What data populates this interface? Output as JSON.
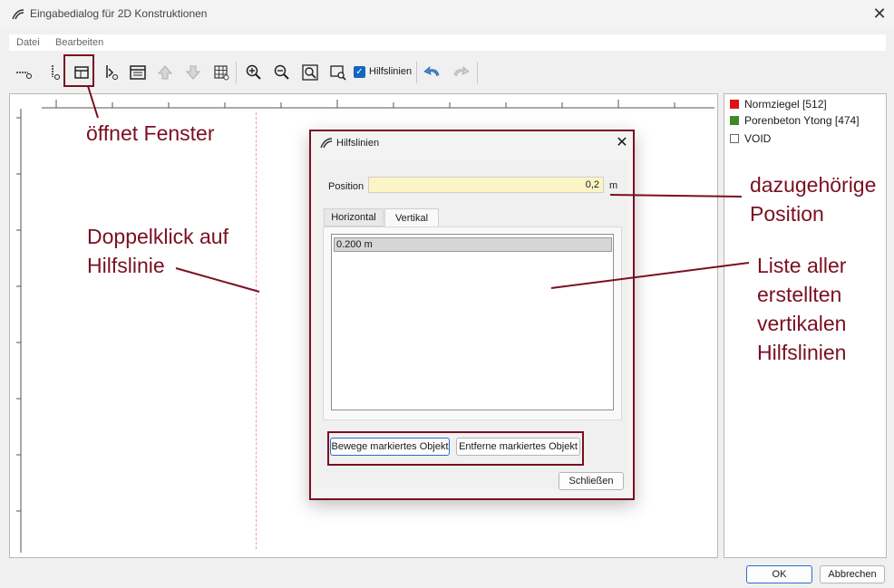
{
  "window": {
    "title": "Eingabedialog für 2D Konstruktionen"
  },
  "menu": {
    "items": [
      "Datei",
      "Bearbeiten"
    ]
  },
  "toolbar": {
    "checkbox_label": "Hilfslinien",
    "checkbox_checked": true
  },
  "legend": {
    "items": [
      {
        "label": "Normziegel [512]",
        "color": "#e01414"
      },
      {
        "label": "Porenbeton Ytong [474]",
        "color": "#3d8a2a"
      },
      {
        "label": "VOID",
        "color": "#ffffff"
      }
    ]
  },
  "buttons": {
    "ok": "OK",
    "cancel": "Abbrechen"
  },
  "dialog": {
    "title": "Hilfslinien",
    "position_label": "Position",
    "position_value": "0,2",
    "unit": "m",
    "tabs": [
      "Horizontal",
      "Vertikal"
    ],
    "active_tab": "Vertikal",
    "list_items": [
      "0.200 m"
    ],
    "move_button": "Bewege markiertes Objekt",
    "remove_button": "Entferne markiertes Objekt",
    "close_button": "Schließen"
  },
  "annotations": {
    "opens_window": "öffnet Fenster",
    "double_click_1": "Doppelklick auf",
    "double_click_2": "Hilfslinie",
    "position_1": "dazugehörige",
    "position_2": "Position",
    "list_1": "Liste aller",
    "list_2": "erstellten",
    "list_3": "vertikalen",
    "list_4": "Hilfslinien",
    "color": "#7a0f22"
  }
}
